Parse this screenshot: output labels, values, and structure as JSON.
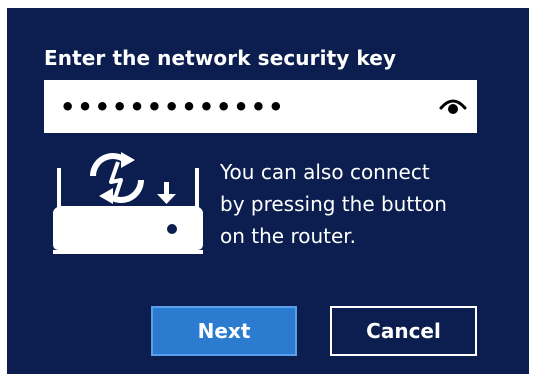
{
  "prompt": {
    "label": "Enter the network security key"
  },
  "security_key": {
    "value": "•••••••••••••",
    "reveal_icon": "eye-icon"
  },
  "router": {
    "icon": "router-wps-icon",
    "help_text": "You can also connect\nby pressing the button\non the router."
  },
  "buttons": {
    "next_label": "Next",
    "cancel_label": "Cancel"
  },
  "colors": {
    "background": "#0b1e4f",
    "primary_button": "#2b7bd1",
    "text": "#ffffff"
  }
}
